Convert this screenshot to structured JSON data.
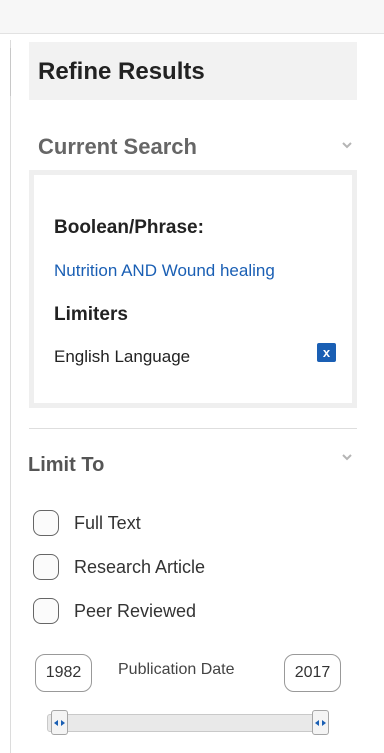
{
  "panel": {
    "title": "Refine Results"
  },
  "current_search": {
    "title": "Current Search",
    "boolean_label": "Boolean/Phrase:",
    "boolean_value": "Nutrition AND Wound healing",
    "limiters_label": "Limiters",
    "limiters": [
      {
        "label": "English Language",
        "remove_label": "x"
      }
    ]
  },
  "limit_to": {
    "title": "Limit To",
    "options": [
      {
        "label": "Full Text",
        "checked": false
      },
      {
        "label": "Research Article",
        "checked": false
      },
      {
        "label": "Peer Reviewed",
        "checked": false
      }
    ]
  },
  "publication_date": {
    "label": "Publication Date",
    "start_year": "1982",
    "end_year": "2017",
    "range_start_fraction": 0.0,
    "range_end_fraction": 1.0
  },
  "colors": {
    "link_blue": "#1a5fb4",
    "header_bg": "#f2f2f2",
    "section_title_gray": "#666666"
  },
  "icons": {
    "collapse": "chevron-down-icon",
    "remove": "close-icon",
    "slider_handle": "double-arrow-icon"
  }
}
